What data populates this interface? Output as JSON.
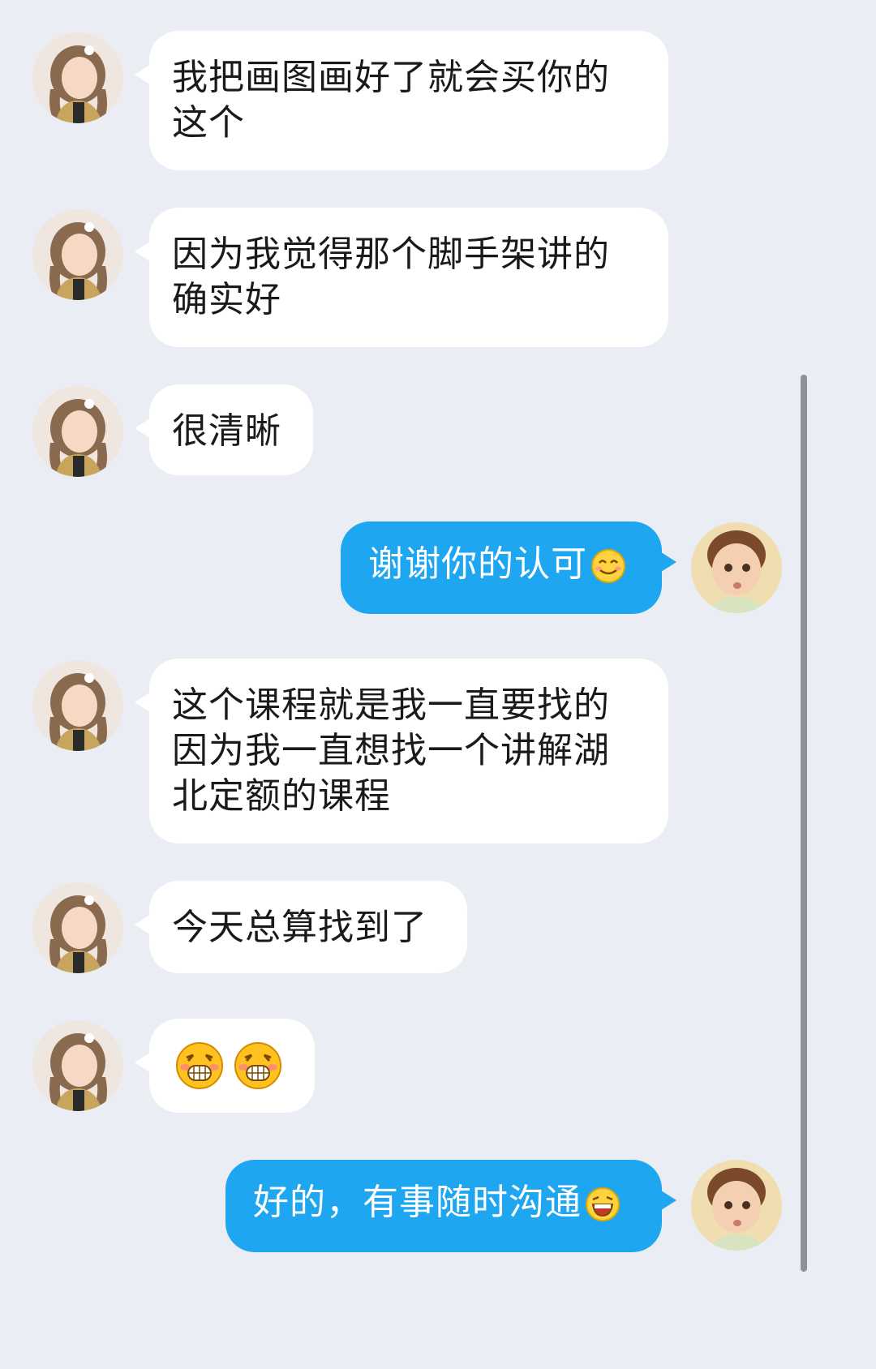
{
  "chat": {
    "messages": [
      {
        "side": "left",
        "text": "我把画图画好了就会买你的这个"
      },
      {
        "side": "left",
        "text": "因为我觉得那个脚手架讲的确实好"
      },
      {
        "side": "left",
        "text": "很清晰"
      },
      {
        "side": "right",
        "text": "谢谢你的认可",
        "emoji": "smile-emoji"
      },
      {
        "side": "left",
        "text": "这个课程就是我一直要找的因为我一直想找一个讲解湖北定额的课程"
      },
      {
        "side": "left",
        "text": "今天总算找到了"
      },
      {
        "side": "left",
        "emoji": [
          "grin-emoji",
          "grin-emoji"
        ]
      },
      {
        "side": "right",
        "text": "好的，有事随时沟通",
        "emoji": "laugh-emoji"
      }
    ]
  },
  "colors": {
    "background": "#eaedf3",
    "left_bubble": "#ffffff",
    "right_bubble": "#1ea7f0",
    "right_text": "#ffffff"
  }
}
